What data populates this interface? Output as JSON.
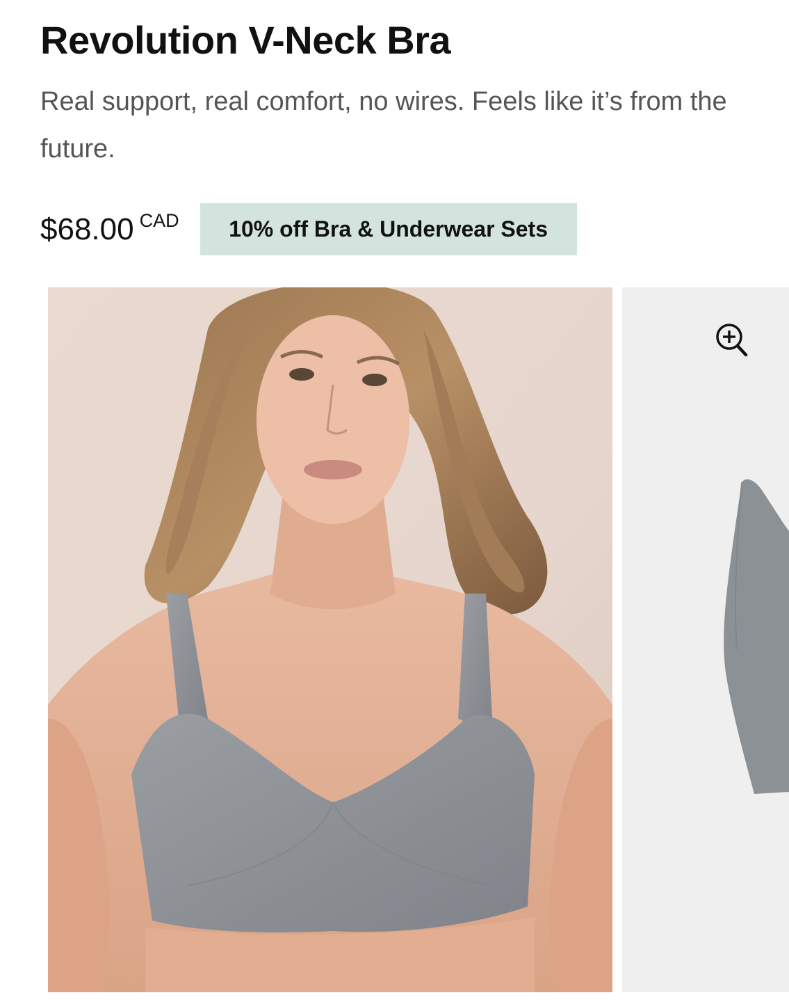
{
  "product": {
    "title": "Revolution V-Neck Bra",
    "description": "Real support, real comfort, no wires. Feels like it’s from the future.",
    "price": "$68.00",
    "currency": "CAD",
    "promo": "10% off Bra & Underwear Sets"
  },
  "colors": {
    "promo_bg": "#d3e4df",
    "bra_gray": "#8f9398",
    "alt_bg": "#efefef"
  },
  "gallery": {
    "main_image": "model-wearing-gray-bra",
    "alt_image": "gray-bra-product-flat",
    "zoom_icon": "zoom-in-icon"
  }
}
